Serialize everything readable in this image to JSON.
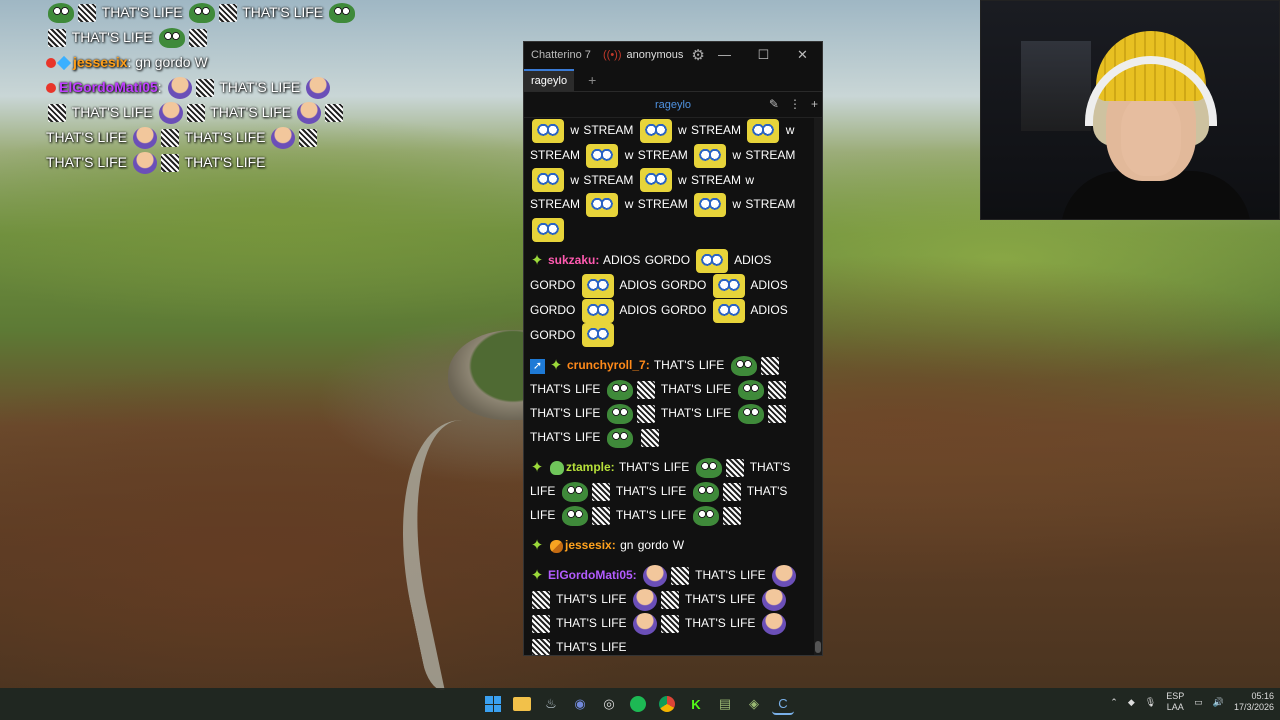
{
  "overlay": {
    "lines": [
      {
        "text": "THAT'S LIFE"
      },
      {
        "text": "THAT'S LIFE"
      },
      {
        "text": "THAT'S LIFE"
      },
      {
        "user": "jessesix",
        "msg": "gn gordo W"
      },
      {
        "user": "ElGordoMati05",
        "msg": "THAT'S LIFE"
      },
      {
        "text": "THAT'S LIFE"
      },
      {
        "text": "THAT'S LIFE"
      },
      {
        "text": "THAT'S LIFE"
      },
      {
        "text": "THAT'S LIFE"
      },
      {
        "text": "THAT'S LIFE"
      },
      {
        "text": "THAT'S LIFE"
      }
    ]
  },
  "chatterino": {
    "title": "Chatterino 7...",
    "user": "anonymous",
    "tab": "rageylo",
    "channel": "rageylo",
    "window_buttons": {
      "minimize": "—",
      "maximize": "☐",
      "close": "✕"
    }
  },
  "chat": {
    "stream_word": "w STREAM",
    "sukzaku": {
      "name": "sukzaku:",
      "w1": "ADIOS GORDO",
      "w2": "ADIOS",
      "w3": "GORDO"
    },
    "crunchy": {
      "name": "crunchyroll_7:",
      "w1": "THAT'S LIFE",
      "w2": "THAT'S",
      "w3": "LIFE"
    },
    "ztample": {
      "name": "ztample:",
      "w1": "THAT'S LIFE"
    },
    "jesse": {
      "name": "jessesix:",
      "msg": "gn gordo W"
    },
    "gordo": {
      "name": "ElGordoMati05:",
      "w1": "THAT'S LIFE"
    }
  },
  "taskbar": {
    "lang_top": "ESP",
    "lang_bottom": "LAA",
    "time": "05:16",
    "date": "17/3/2026"
  },
  "colors": {
    "accent": "#3a7bd5",
    "channel": "#4f92e0",
    "sukzaku": "#ff5ab0",
    "crunchy": "#ff8a1a",
    "ztample": "#b7e13a",
    "jesse": "#ffa21e",
    "gordo": "#b35cff"
  }
}
